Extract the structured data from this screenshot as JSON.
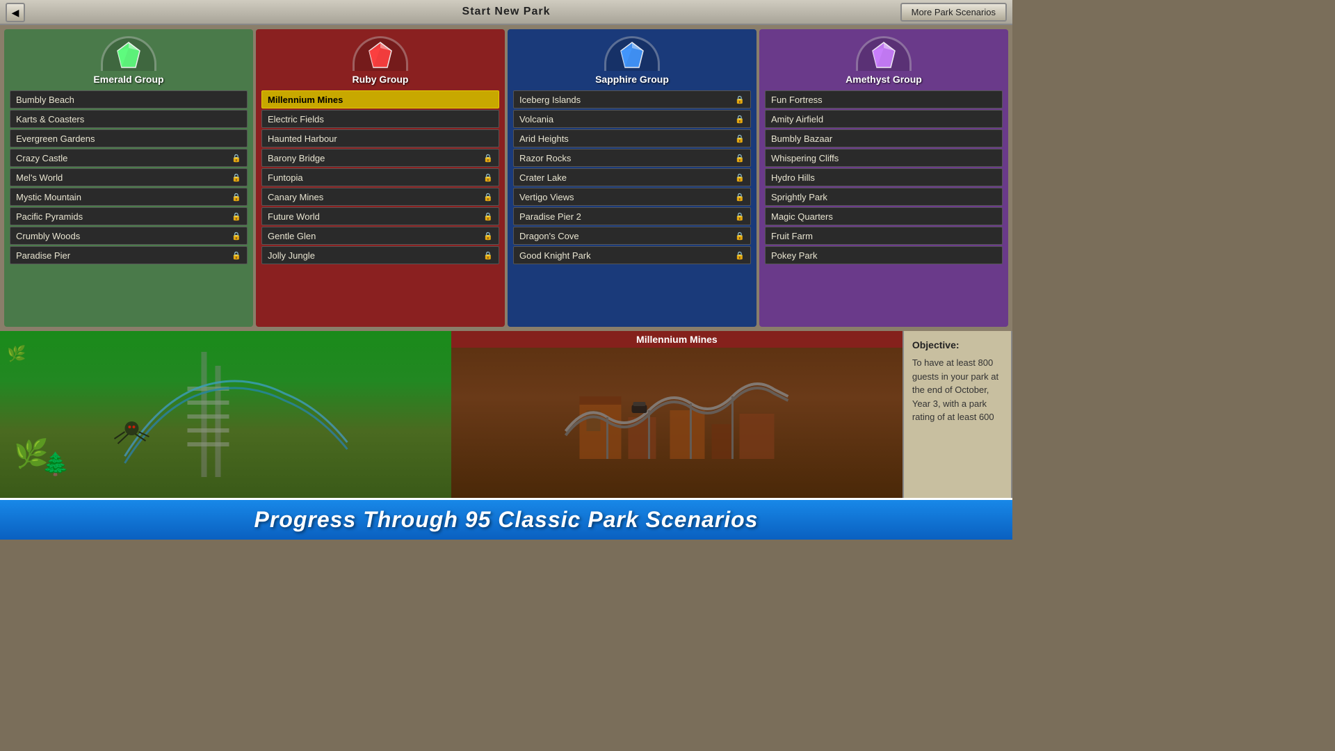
{
  "header": {
    "title": "Start New Park",
    "back_label": "◀",
    "more_scenarios_label": "More Park Scenarios"
  },
  "groups": [
    {
      "id": "emerald",
      "name": "Emerald Group",
      "gem": "◆",
      "gem_class": "gem-emerald",
      "scenarios": [
        {
          "name": "Bumbly Beach",
          "locked": false
        },
        {
          "name": "Karts & Coasters",
          "locked": false
        },
        {
          "name": "Evergreen Gardens",
          "locked": false
        },
        {
          "name": "Crazy Castle",
          "locked": true
        },
        {
          "name": "Mel's World",
          "locked": true
        },
        {
          "name": "Mystic Mountain",
          "locked": true
        },
        {
          "name": "Pacific Pyramids",
          "locked": true
        },
        {
          "name": "Crumbly Woods",
          "locked": true
        },
        {
          "name": "Paradise Pier",
          "locked": true
        }
      ]
    },
    {
      "id": "ruby",
      "name": "Ruby Group",
      "gem": "◆",
      "gem_class": "gem-ruby",
      "scenarios": [
        {
          "name": "Millennium Mines",
          "locked": false,
          "selected": true
        },
        {
          "name": "Electric Fields",
          "locked": false
        },
        {
          "name": "Haunted Harbour",
          "locked": false
        },
        {
          "name": "Barony Bridge",
          "locked": true
        },
        {
          "name": "Funtopia",
          "locked": true
        },
        {
          "name": "Canary Mines",
          "locked": true
        },
        {
          "name": "Future World",
          "locked": true
        },
        {
          "name": "Gentle Glen",
          "locked": true
        },
        {
          "name": "Jolly Jungle",
          "locked": true
        }
      ]
    },
    {
      "id": "sapphire",
      "name": "Sapphire Group",
      "gem": "◆",
      "gem_class": "gem-sapphire",
      "scenarios": [
        {
          "name": "Iceberg Islands",
          "locked": true
        },
        {
          "name": "Volcania",
          "locked": true
        },
        {
          "name": "Arid Heights",
          "locked": true
        },
        {
          "name": "Razor Rocks",
          "locked": true
        },
        {
          "name": "Crater Lake",
          "locked": true
        },
        {
          "name": "Vertigo Views",
          "locked": true
        },
        {
          "name": "Paradise Pier 2",
          "locked": true
        },
        {
          "name": "Dragon's Cove",
          "locked": true
        },
        {
          "name": "Good Knight Park",
          "locked": true
        }
      ]
    },
    {
      "id": "amethyst",
      "name": "Amethyst Group",
      "gem": "◆",
      "gem_class": "gem-amethyst",
      "scenarios": [
        {
          "name": "Fun Fortress",
          "locked": false
        },
        {
          "name": "Amity Airfield",
          "locked": false
        },
        {
          "name": "Bumbly Bazaar",
          "locked": false
        },
        {
          "name": "Whispering Cliffs",
          "locked": false
        },
        {
          "name": "Hydro Hills",
          "locked": false
        },
        {
          "name": "Sprightly Park",
          "locked": false
        },
        {
          "name": "Magic Quarters",
          "locked": false
        },
        {
          "name": "Fruit Farm",
          "locked": false
        },
        {
          "name": "Pokey Park",
          "locked": false
        }
      ]
    }
  ],
  "preview": {
    "selected_name": "Millennium Mines",
    "objective_title": "Objective:",
    "objective_text": "To have at least 800 guests in your park at the end of October, Year 3, with a park rating of at least 600"
  },
  "banner": {
    "text": "Progress Through 95 Classic Park Scenarios"
  }
}
